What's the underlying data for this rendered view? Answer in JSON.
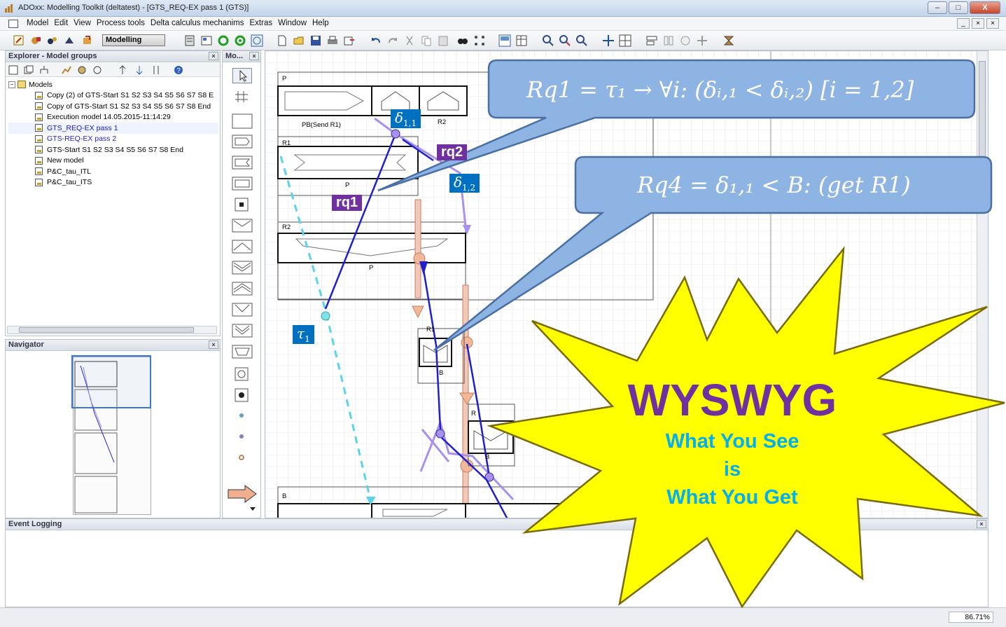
{
  "window": {
    "title": "ADOxx: Modelling Toolkit (deltatest) - [GTS_REQ-EX pass 1 (GTS)]",
    "buttons": [
      "–",
      "□",
      "X"
    ]
  },
  "menubar": {
    "items": [
      "Model",
      "Edit",
      "View",
      "Process tools",
      "Delta calculus mechanims",
      "Extras",
      "Window",
      "Help"
    ],
    "mdi_buttons": [
      "_",
      "×",
      "×"
    ]
  },
  "toolbar": {
    "mode": "Modelling"
  },
  "explorer": {
    "title": "Explorer - Model groups",
    "root": "Models",
    "models": [
      "Copy (2) of GTS-Start S1 S2 S3 S4 S5 S6 S7 S8 E",
      "Copy of GTS-Start S1 S2 S3 S4 S5 S6 S7 S8 End",
      "Execution model 14.05.2015-11:14:29",
      "GTS_REQ-EX pass 1",
      "GTS-REQ-EX pass 2",
      "GTS-Start S1 S2 S3 S4 S5 S6 S7 S8 End",
      "New model",
      "P&C_tau_ITL",
      "P&C_tau_ITS"
    ]
  },
  "navigator": {
    "title": "Navigator"
  },
  "modelling_bar": {
    "title": "Mo..."
  },
  "event_logging": {
    "title": "Event Logging"
  },
  "status": {
    "zoom": "86.71%"
  },
  "diagram": {
    "lane_labels": [
      "P",
      "R1",
      "R2",
      "B"
    ],
    "shape_labels": [
      "PB(Send R1)",
      "R2",
      "P",
      "P",
      "R1",
      "B",
      "R",
      "B"
    ],
    "tags": {
      "delta11": "δ",
      "delta11_sub": "1,1",
      "delta12": "δ",
      "delta12_sub": "1,2",
      "rq1": "rq1",
      "rq2": "rq2",
      "tau1": "τ",
      "tau1_sub": "1"
    }
  },
  "callouts": {
    "rq1_formula": "Rq1 = τ₁ → ∀i: (δᵢ,₁ < δᵢ,₂) [i = 1,2]",
    "rq4_formula": "Rq4 = δ₁,₁ < B: (get R1)"
  },
  "starburst": {
    "title": "WYSWYG",
    "lines": [
      "What You See",
      "is",
      "What You Get"
    ]
  },
  "colors": {
    "callout_fill": "#8eb4e3",
    "callout_border": "#4a6fa5",
    "star_fill": "#ffff00",
    "title_color": "#7030a0",
    "subtitle_color": "#00b0f0",
    "tag_blue": "#0070c0",
    "tag_purple": "#7030a0",
    "flow_blue": "#1f1fd0",
    "flow_lavender": "#a890f0",
    "dashed_cyan": "#5ad4e8",
    "pink_bar": "#e8a088"
  }
}
